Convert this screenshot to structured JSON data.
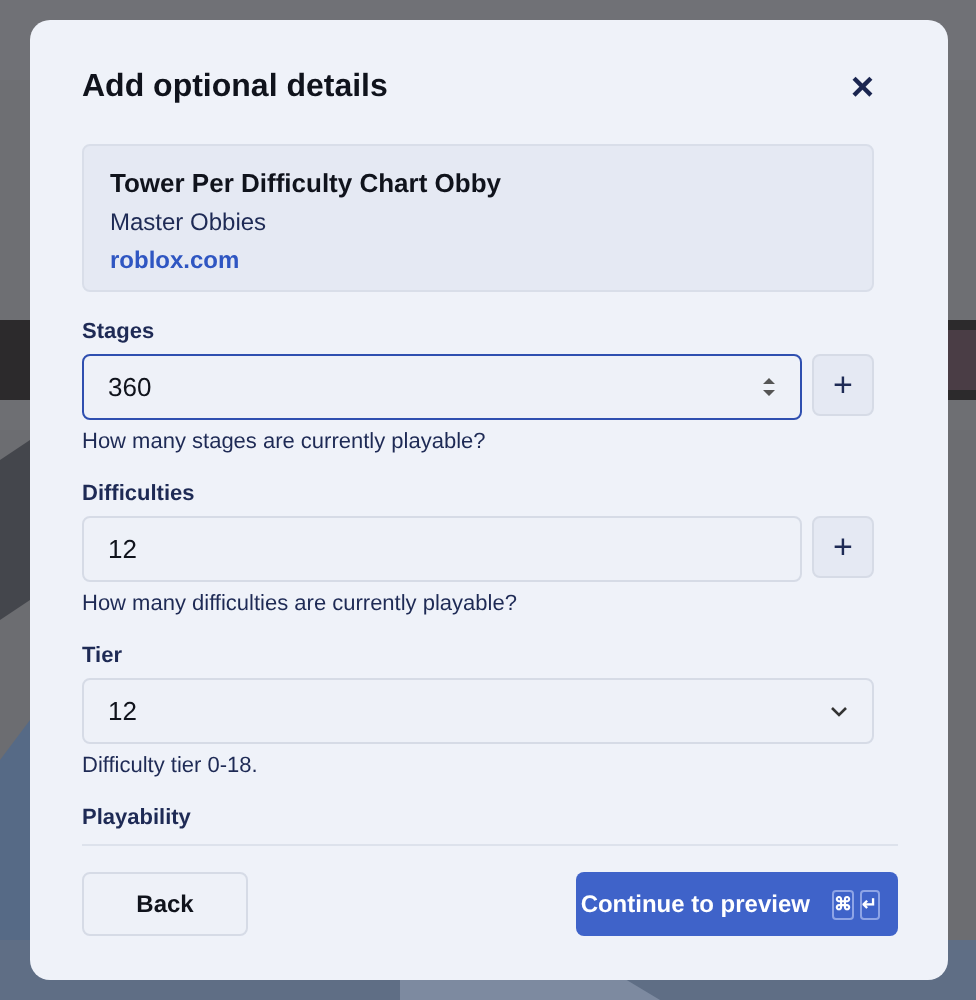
{
  "dialog": {
    "title": "Add optional details",
    "close": "×",
    "game": {
      "name": "Tower Per Difficulty Chart Obby",
      "creator": "Master Obbies",
      "link": "roblox.com"
    },
    "fields": [
      {
        "kind": "number",
        "label": "Stages",
        "value": "360",
        "focused": true,
        "add": "+",
        "hint": "How many stages are currently playable?"
      },
      {
        "kind": "text",
        "label": "Difficulties",
        "value": "12",
        "focused": false,
        "add": "+",
        "hint": "How many difficulties are currently playable?"
      },
      {
        "kind": "select",
        "label": "Tier",
        "value": "12",
        "focused": false,
        "hint": "Difficulty tier 0-18."
      },
      {
        "kind": "label",
        "label": "Playability"
      }
    ],
    "back": "Back",
    "continue": "Continue to preview",
    "keys": [
      "⌘",
      "↵"
    ]
  }
}
